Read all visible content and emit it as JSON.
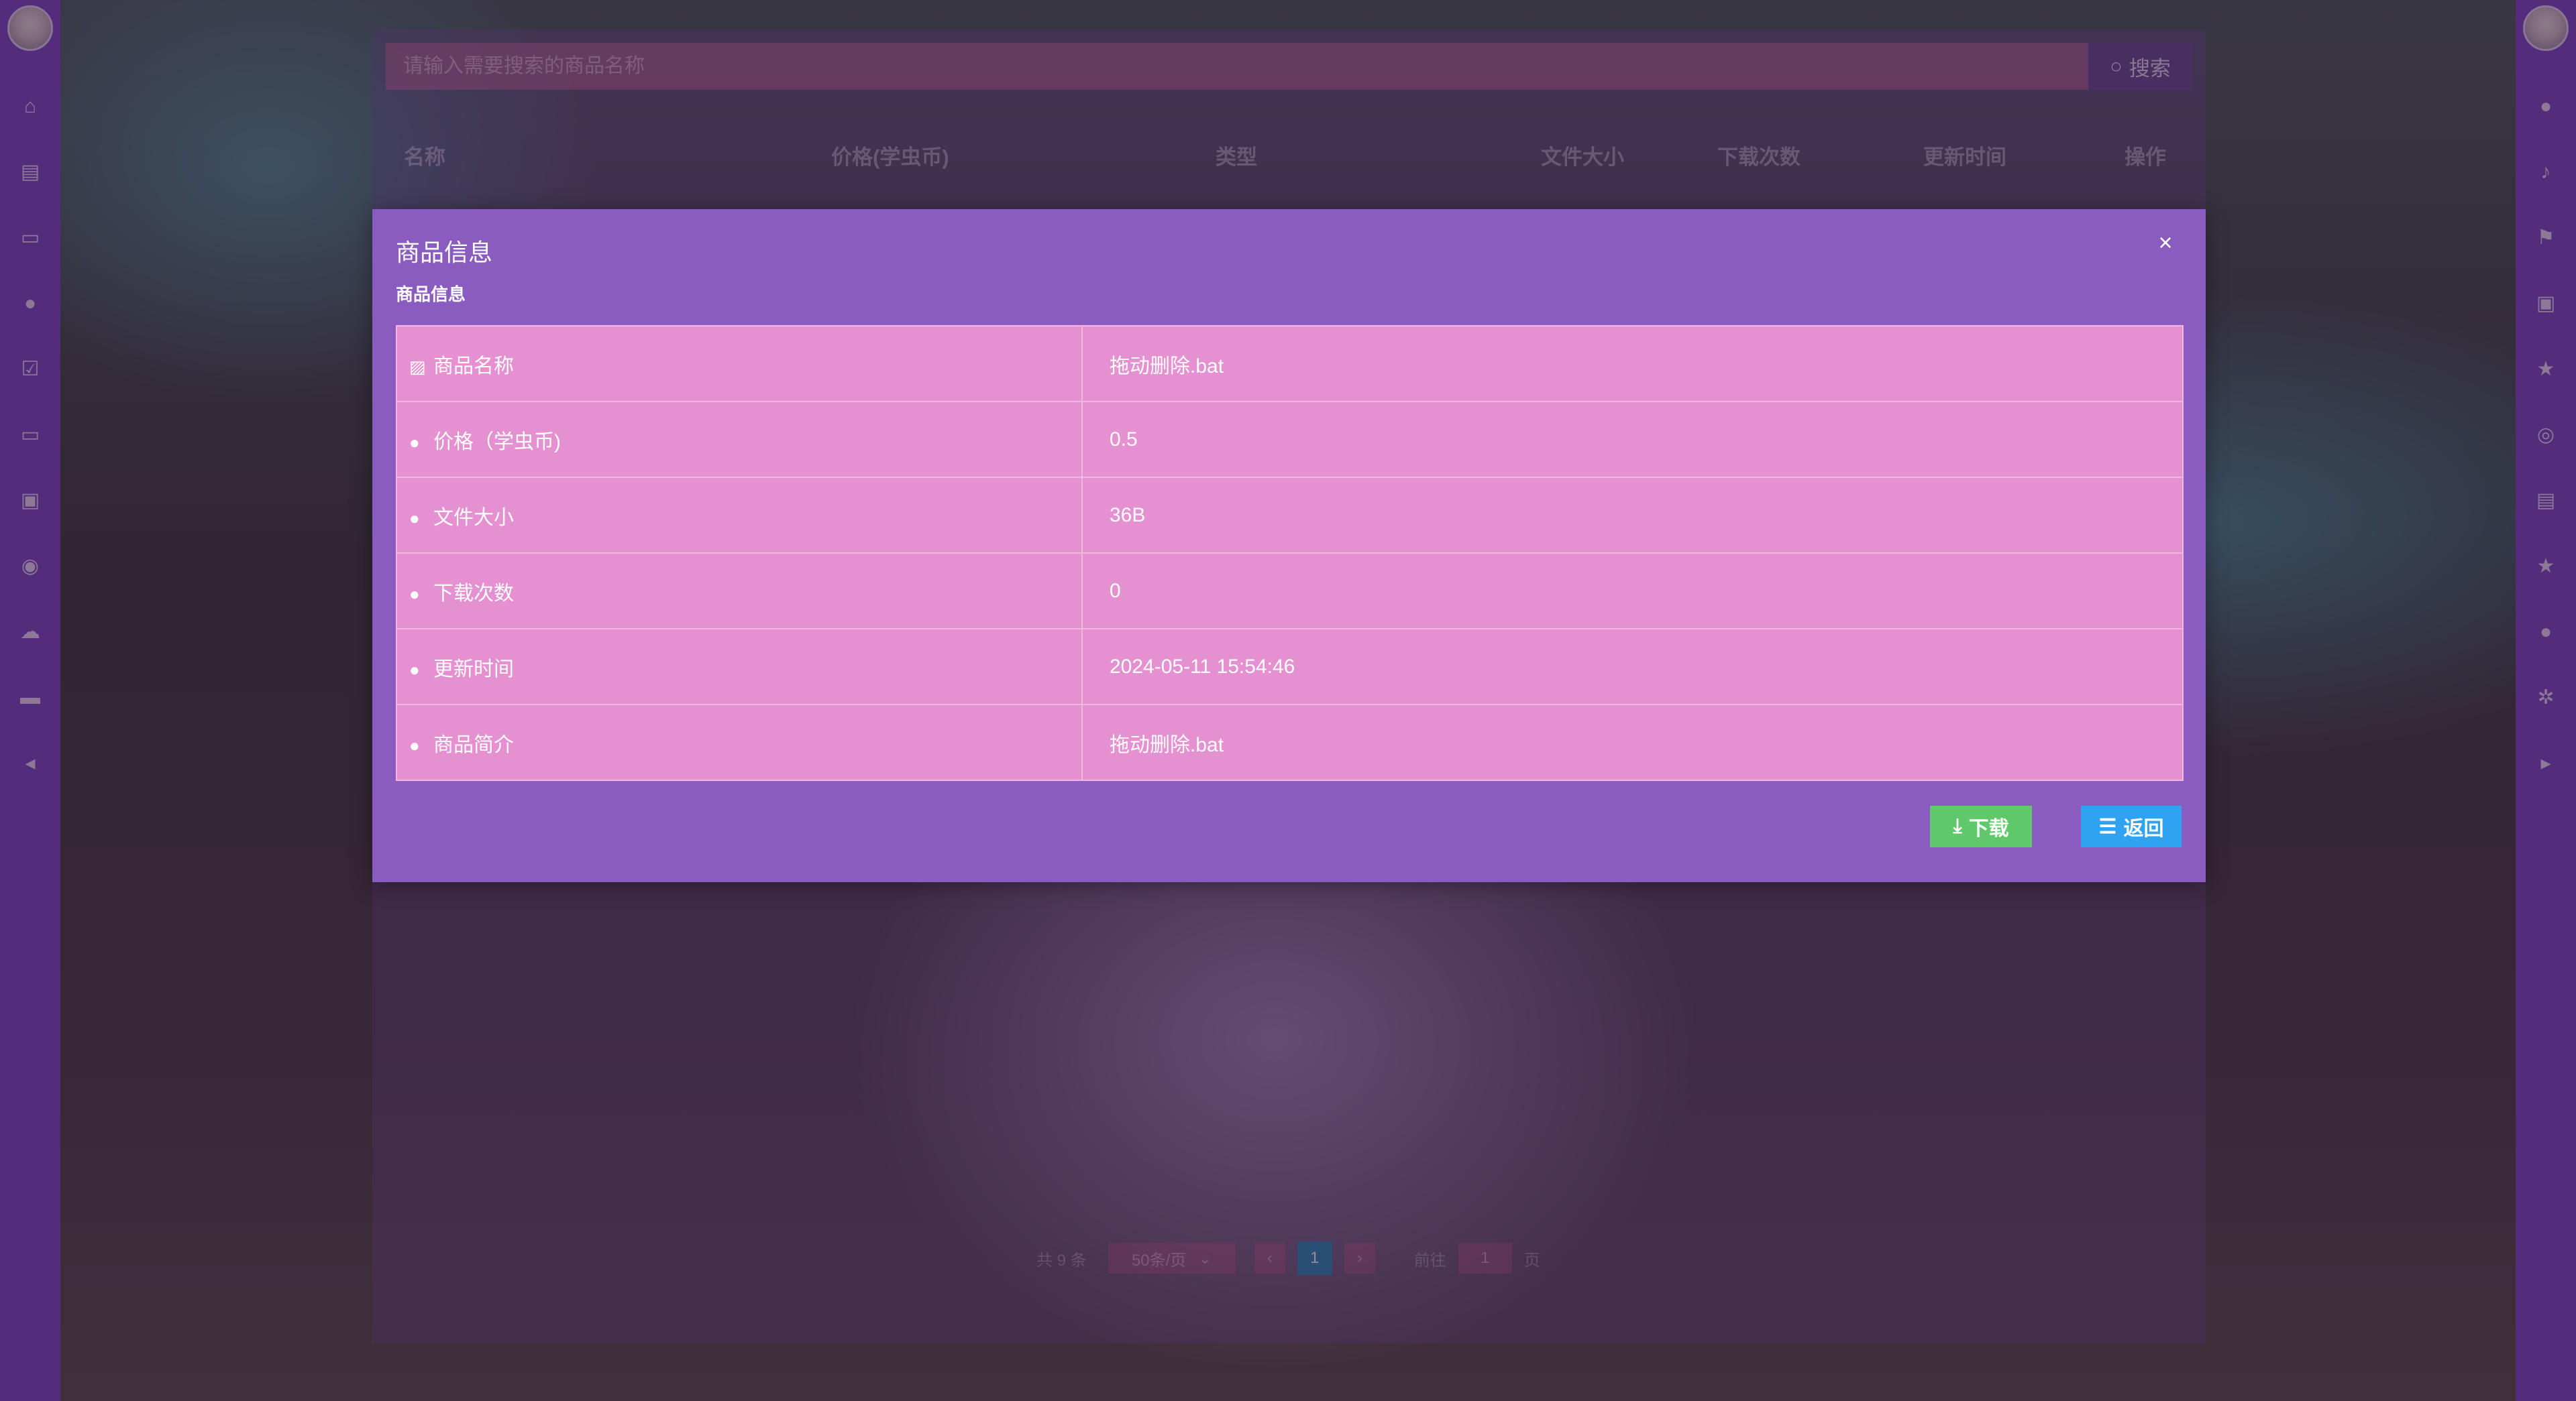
{
  "search": {
    "placeholder": "请输入需要搜索的商品名称",
    "button_label": "搜索"
  },
  "table": {
    "headers": [
      "名称",
      "价格(学虫币)",
      "类型",
      "文件大小",
      "下载次数",
      "更新时间",
      "操作"
    ]
  },
  "pagination": {
    "total_text": "共 9 条",
    "page_size": "50条/页",
    "prev": "‹",
    "current_page": "1",
    "next": "›",
    "goto_prefix": "前往",
    "goto_value": "1",
    "goto_suffix": "页"
  },
  "dialog": {
    "title": "商品信息",
    "subtitle": "商品信息",
    "close": "×",
    "rows": [
      {
        "label": "商品名称",
        "value": "拖动删除.bat",
        "icon": "image-icon"
      },
      {
        "label": "价格（学虫币)",
        "value": "0.5",
        "icon": "user-icon"
      },
      {
        "label": "文件大小",
        "value": "36B",
        "icon": "user-icon"
      },
      {
        "label": "下载次数",
        "value": "0",
        "icon": "user-icon"
      },
      {
        "label": "更新时间",
        "value": "2024-05-11 15:54:46",
        "icon": "user-icon"
      },
      {
        "label": "商品简介",
        "value": "拖动删除.bat",
        "icon": "user-icon"
      }
    ],
    "download_label": "下载",
    "back_label": "返回"
  },
  "left_rail_icons": [
    "home-icon",
    "clipboard-icon",
    "monitor-icon",
    "user-icon",
    "checklist-icon",
    "monitor-icon",
    "camera-icon",
    "map-pin-icon",
    "cloud-upload-icon",
    "chat-icon",
    "collapse-left-icon"
  ],
  "right_rail_icons": [
    "user-icon",
    "bell-icon",
    "flag-icon",
    "camera-icon",
    "star-icon",
    "settings-icon",
    "clipboard-icon",
    "star-icon",
    "user-icon",
    "gear-icon",
    "expand-right-icon"
  ],
  "colors": {
    "rail": "#7f45c7",
    "dialog": "#8a5cc0",
    "table": "#e590d0",
    "download": "#5fc86a",
    "back": "#2fa3f1",
    "page_active": "#2a8ab8"
  }
}
